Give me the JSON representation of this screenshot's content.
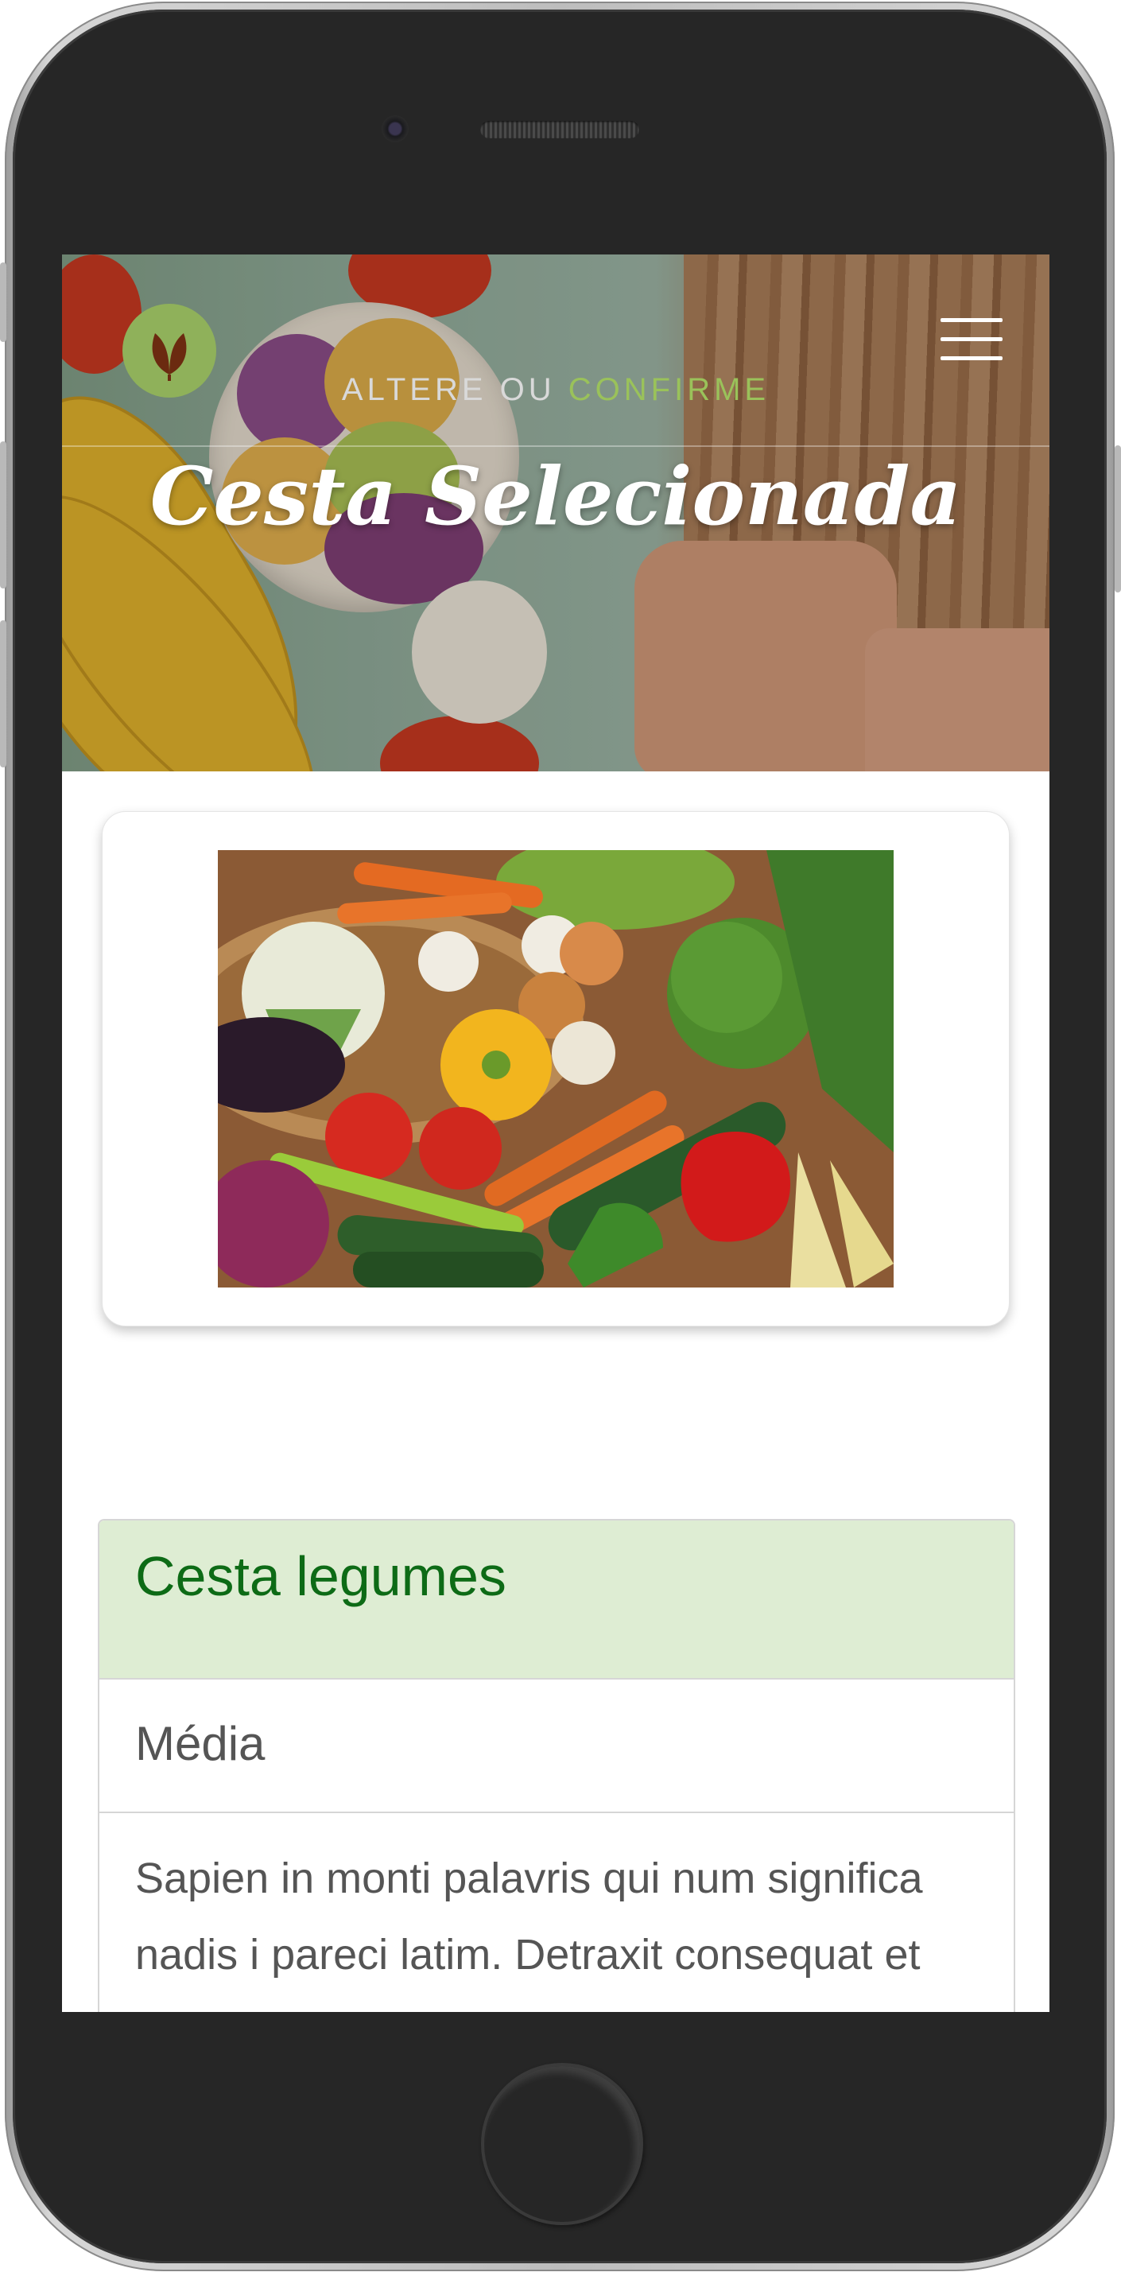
{
  "header": {
    "kicker_part1": "ALTERE OU",
    "kicker_part2": "CONFIRME",
    "title": "Cesta Selecionada"
  },
  "product": {
    "name": "Cesta legumes",
    "size": "Média",
    "description": "Sapien in monti palavris qui num significa nadis i pareci latim. Detraxit consequat et"
  },
  "colors": {
    "accent_green": "#9ac25a",
    "panel_header_bg": "#deedd3",
    "panel_title": "#0d6b16",
    "logo_bg": "#8fb15a"
  },
  "icons": {
    "logo": "leaf-logo-icon",
    "menu": "hamburger-menu-icon"
  }
}
